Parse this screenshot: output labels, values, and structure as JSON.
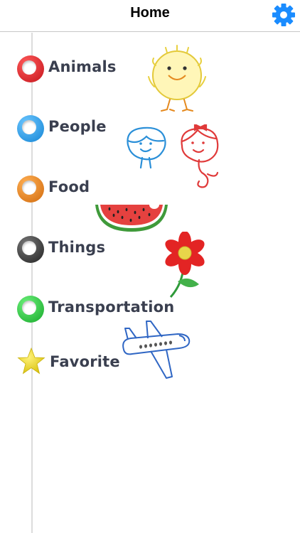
{
  "header": {
    "title": "Home",
    "settings_icon": "gear-icon",
    "accent": "#1a8cff"
  },
  "categories": [
    {
      "label": "Animals",
      "color": "#e0242a",
      "icon": "red-ring-icon"
    },
    {
      "label": "People",
      "color": "#1f9be8",
      "icon": "blue-ring-icon"
    },
    {
      "label": "Food",
      "color": "#e07a1a",
      "icon": "orange-ring-icon"
    },
    {
      "label": "Things",
      "color": "#333333",
      "icon": "black-ring-icon"
    },
    {
      "label": "Transportation",
      "color": "#22c33a",
      "icon": "green-ring-icon"
    },
    {
      "label": "Favorite",
      "color": "#f2dd29",
      "icon": "star-icon"
    }
  ],
  "illustrations": [
    "chick-drawing",
    "boy-face-drawing",
    "girl-drawing",
    "watermelon-drawing",
    "flower-drawing",
    "airplane-drawing"
  ]
}
